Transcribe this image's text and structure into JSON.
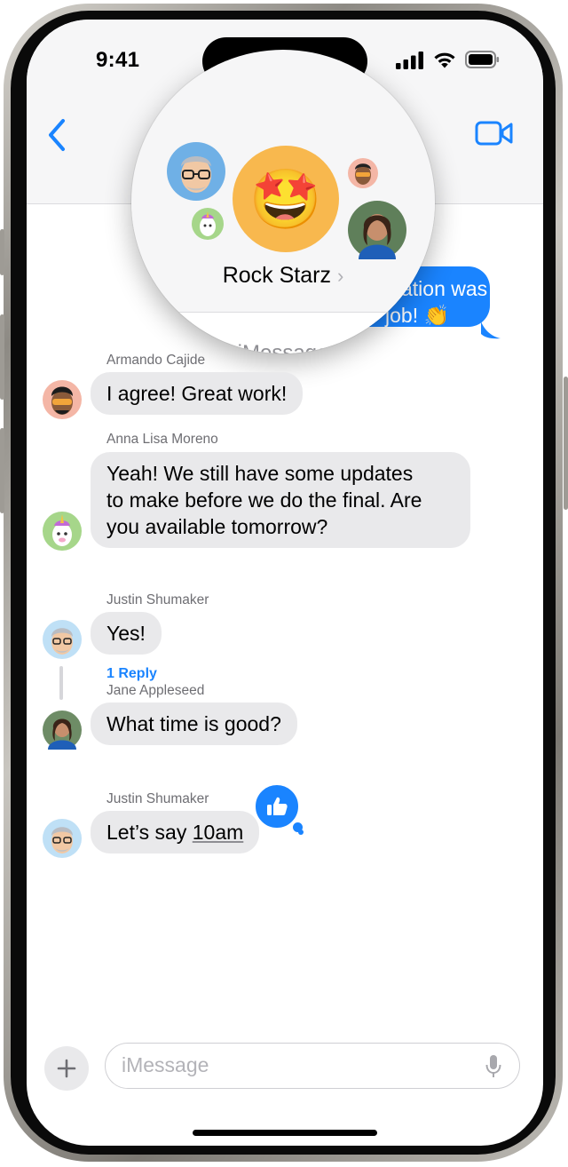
{
  "status_bar": {
    "time": "9:41"
  },
  "header": {
    "group_name": "Rock Starz",
    "back_icon": "chevron-left-icon",
    "video_icon": "video-camera-icon"
  },
  "thread": {
    "service_label": "iMessage",
    "sent_message": {
      "line1": "ation was",
      "line2": "job! 👏"
    },
    "messages": [
      {
        "sender": "Armando Cajide",
        "lines": [
          "I agree! Great work!"
        ]
      },
      {
        "sender": "Anna Lisa Moreno",
        "lines": [
          "Yeah! We still have some updates",
          "to make before we do the final. Are",
          "you available tomorrow?"
        ]
      },
      {
        "sender": "Justin Shumaker",
        "lines": [
          "Yes!"
        ]
      },
      {
        "sender": "Jane Appleseed",
        "lines": [
          "What time is good?"
        ]
      },
      {
        "sender": "Justin Shumaker",
        "text_prefix": "Let’s say ",
        "text_link": "10am"
      }
    ],
    "reply_count_label": "1 Reply",
    "tapback_icon": "thumbs-up-icon",
    "star_struck_emoji": "🤩"
  },
  "input_bar": {
    "placeholder": "iMessage",
    "plus_icon": "plus-icon",
    "mic_icon": "microphone-icon"
  },
  "colors": {
    "accent": "#1a84ff",
    "bubble_gray": "#e9e9eb",
    "nav_bg": "#f6f6f7"
  }
}
